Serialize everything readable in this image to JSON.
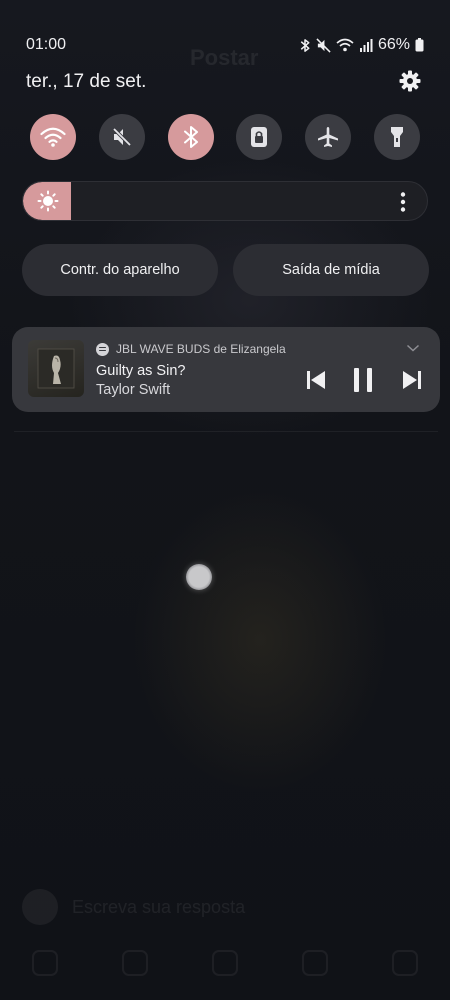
{
  "background_app": {
    "title": "Postar",
    "reply_placeholder": "Escreva sua resposta"
  },
  "status_bar": {
    "time": "01:00",
    "battery": "66%",
    "icons": [
      "bluetooth-icon",
      "mute-icon",
      "wifi-icon",
      "signal-icon",
      "battery-icon"
    ]
  },
  "header": {
    "date": "ter., 17 de set.",
    "settings_icon": "gear-icon"
  },
  "quick_toggles": [
    {
      "name": "wifi",
      "icon": "wifi-icon",
      "on": true
    },
    {
      "name": "sound",
      "icon": "mute-icon",
      "on": false
    },
    {
      "name": "bluetooth",
      "icon": "bluetooth-icon",
      "on": true
    },
    {
      "name": "secure-folder",
      "icon": "lock-icon",
      "on": false
    },
    {
      "name": "airplane-mode",
      "icon": "airplane-icon",
      "on": false
    },
    {
      "name": "flashlight",
      "icon": "flashlight-icon",
      "on": false
    }
  ],
  "brightness": {
    "level_percent": 12
  },
  "buttons": {
    "device_control": "Contr. do aparelho",
    "media_output": "Saída de mídia"
  },
  "media": {
    "source": "JBL WAVE BUDS de Elizangela",
    "title": "Guilty as Sin?",
    "artist": "Taylor Swift",
    "app_icon": "spotify-icon",
    "controls": [
      "previous-icon",
      "pause-icon",
      "next-icon"
    ]
  },
  "colors": {
    "accent": "#d69a9c",
    "toggle_off": "#3b3c42",
    "card": "#37383d",
    "background": "#121419"
  }
}
